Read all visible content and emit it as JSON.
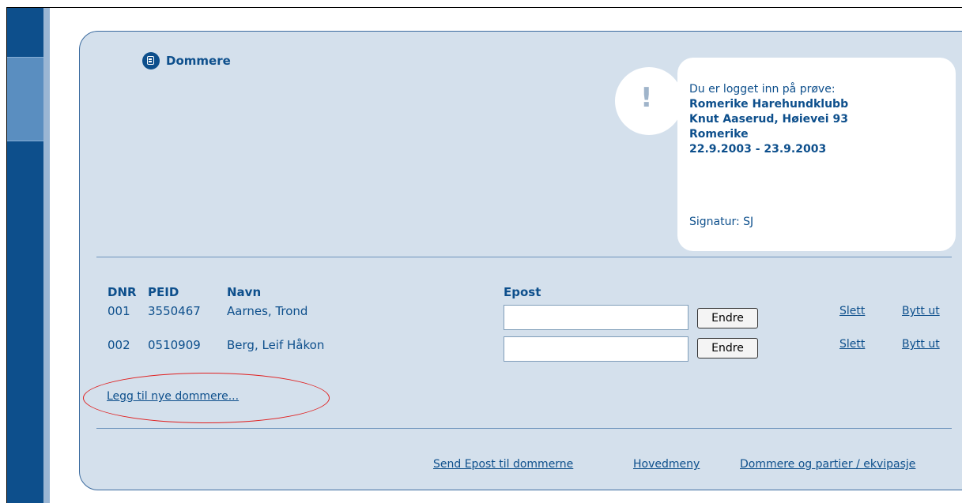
{
  "header": {
    "title": "Dommere"
  },
  "info": {
    "intro": "Du er logget inn på prøve:",
    "club": "Romerike Harehundklubb",
    "address": "Knut Aaserud, Høievei 93",
    "region": "Romerike",
    "dates": "22.9.2003 - 23.9.2003",
    "signature": "Signatur: SJ"
  },
  "table": {
    "columns": [
      "DNR",
      "PEID",
      "Navn",
      "Epost"
    ],
    "rows": [
      {
        "dnr": "001",
        "peid": "3550467",
        "navn": "Aarnes, Trond",
        "epost": "",
        "endre": "Endre",
        "slett": "Slett",
        "bytt": "Bytt ut"
      },
      {
        "dnr": "002",
        "peid": "0510909",
        "navn": "Berg, Leif Håkon",
        "epost": "",
        "endre": "Endre",
        "slett": "Slett",
        "bytt": "Bytt ut"
      }
    ]
  },
  "add_link": "Legg til nye dommere...",
  "footer": {
    "send": "Send Epost til dommerne",
    "main": "Hovedmeny",
    "parties": "Dommere og partier / ekvipasje"
  },
  "colors": {
    "accent": "#0d4f8c",
    "panel": "#d4e0ec",
    "highlight": "#e02020"
  }
}
